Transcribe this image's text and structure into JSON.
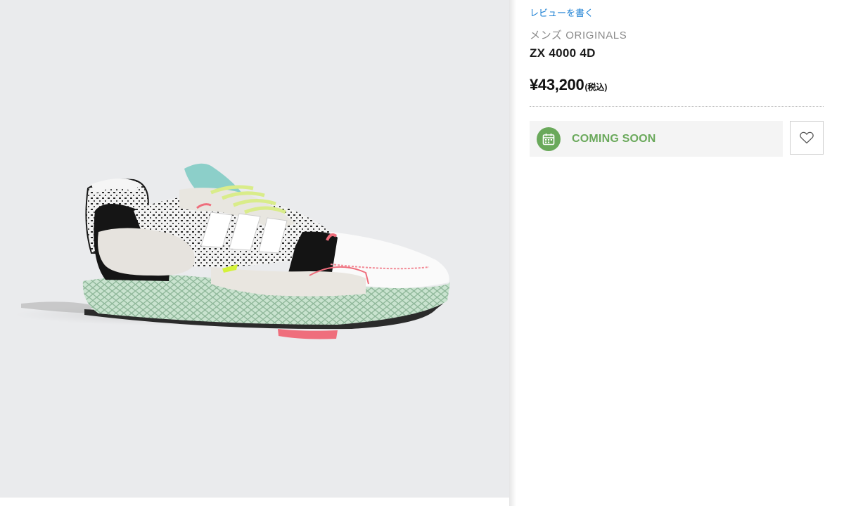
{
  "product": {
    "review_link": "レビューを書く",
    "category": "メンズ ORIGINALS",
    "name": "ZX 4000 4D",
    "price": "¥43,200",
    "tax_note": "(税込)",
    "status_label": "COMING SOON"
  },
  "icons": {
    "status": "calendar-icon",
    "wishlist": "heart-icon"
  },
  "colors": {
    "link": "#1a7fd3",
    "status_green": "#6aa95b",
    "image_bg": "#eaebed",
    "status_bar_bg": "#f4f4f4"
  }
}
